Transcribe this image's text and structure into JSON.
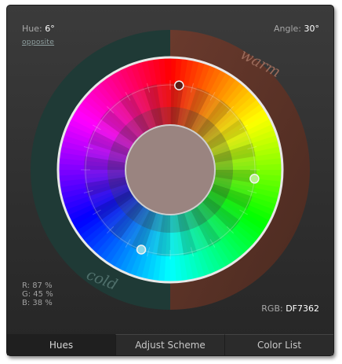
{
  "hue": {
    "label": "Hue:",
    "value": "6°"
  },
  "angle": {
    "label": "Angle:",
    "value": "30°"
  },
  "opposite_link": "opposite",
  "wheel": {
    "warm_label": "warm",
    "cold_label": "cold",
    "center_color": "#9a8480",
    "warm_ring_color": "#5a3227",
    "cold_ring_color": "#1f3a36",
    "markers": [
      {
        "name": "marker-primary",
        "color": "#5c1f17",
        "hue_deg": 6
      },
      {
        "name": "marker-secondary-1",
        "color": "#b6f28a",
        "hue_deg": 96
      },
      {
        "name": "marker-secondary-2",
        "color": "#8ad7e8",
        "hue_deg": 200
      }
    ]
  },
  "rgb_percent": {
    "r": "R: 87 %",
    "g": "G: 45 %",
    "b": "B: 38 %"
  },
  "rgb": {
    "label": "RGB:",
    "value": "DF7362"
  },
  "tabs": [
    {
      "label": "Hues",
      "active": true
    },
    {
      "label": "Adjust Scheme",
      "active": false
    },
    {
      "label": "Color List",
      "active": false
    }
  ]
}
